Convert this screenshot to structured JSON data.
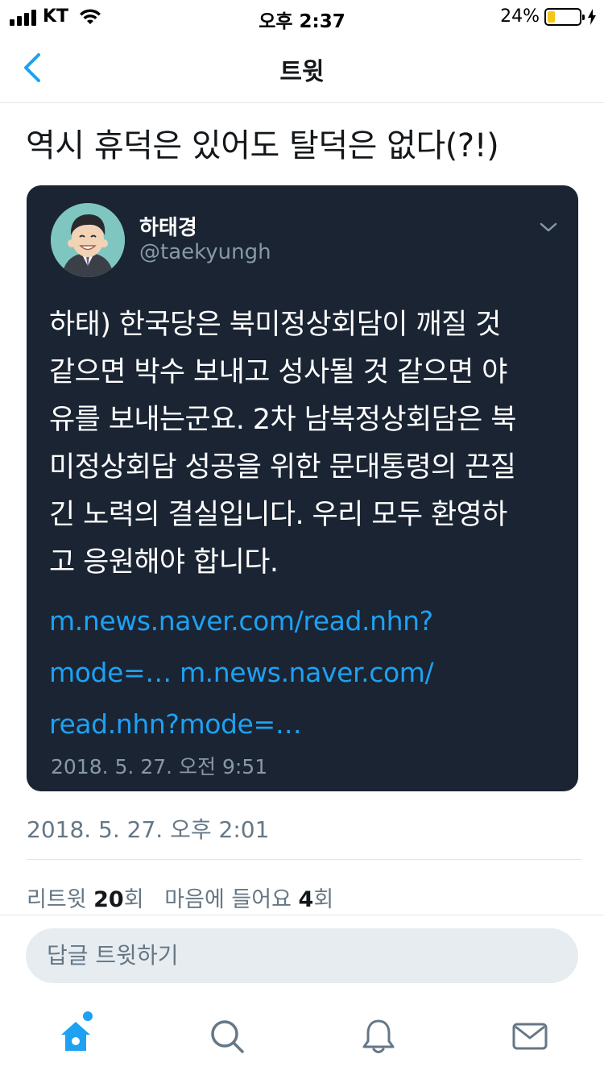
{
  "status_bar": {
    "carrier": "KT",
    "time": "오후 2:37",
    "battery_percent": "24%",
    "battery_level": 0.24
  },
  "nav": {
    "title": "트윗"
  },
  "tweet": {
    "text": "역시 휴덕은 있어도 탈덕은 없다(?!)",
    "timestamp": "2018. 5. 27. 오후 2:01",
    "retweet_label": "리트윗",
    "retweet_count": "20",
    "retweet_unit": "회",
    "likes_label": "마음에 들어요",
    "likes_count": "4",
    "likes_unit": "회"
  },
  "quoted_tweet": {
    "name": "하태경",
    "handle": "@taekyungh",
    "body_lines": [
      "하태) 한국당은 북미정상회담이 깨질 것",
      "같으면 박수 보내고 성사될 것 같으면 야",
      "유를 보내는군요. 2차 남북정상회담은 북",
      "미정상회담 성공을 위한 문대통령의 끈질",
      "긴 노력의 결실입니다. 우리 모두 환영하",
      "고 응원해야 합니다."
    ],
    "links": {
      "line1": "m.news.naver.com/read.nhn?",
      "line2a": "mode=…",
      "line2b": "m.news.naver.com/",
      "line3": "read.nhn?mode=…"
    },
    "timestamp": "2018. 5. 27. 오전 9:51"
  },
  "reply": {
    "placeholder": "답글 트윗하기"
  },
  "tab_bar": {
    "items": [
      "home-icon",
      "search-icon",
      "bell-icon",
      "mail-icon"
    ],
    "active": "home-icon"
  },
  "colors": {
    "accent": "#1da1f2",
    "quote_background": "#1a2433",
    "secondary_text": "#657786",
    "battery": "#f5c518"
  }
}
